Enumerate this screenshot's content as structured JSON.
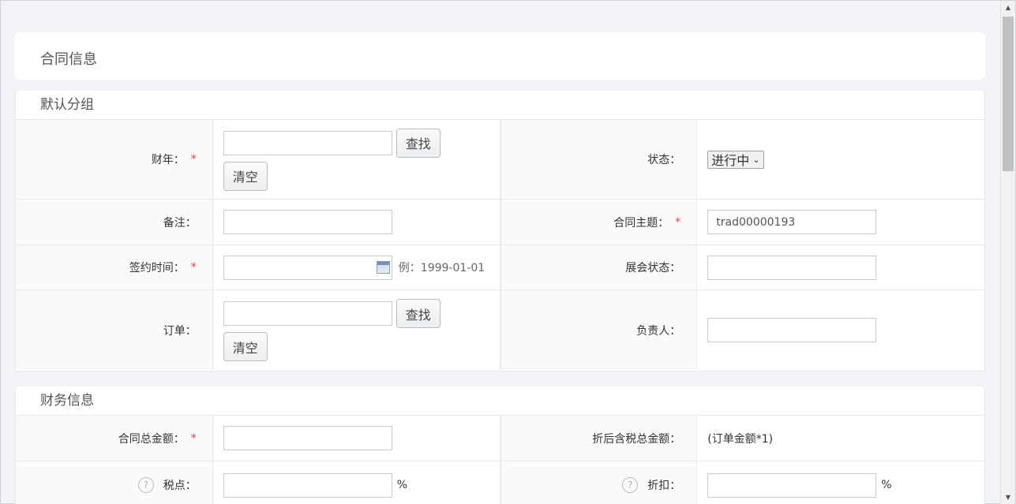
{
  "header": {
    "title": "合同信息"
  },
  "default_group": {
    "title": "默认分组",
    "fiscal_year": {
      "label": "财年：",
      "required": "*",
      "value": "",
      "find_label": "查找",
      "clear_label": "清空"
    },
    "status": {
      "label": "状态：",
      "selected": "进行中"
    },
    "remark": {
      "label": "备注：",
      "value": ""
    },
    "contract_subject": {
      "label": "合同主题：",
      "required": "*",
      "value": "trad00000193"
    },
    "sign_time": {
      "label": "签约时间：",
      "required": "*",
      "value": "",
      "example": "例：1999-01-01"
    },
    "exhibition_status": {
      "label": "展会状态：",
      "value": ""
    },
    "order": {
      "label": "订单：",
      "value": "",
      "find_label": "查找",
      "clear_label": "清空"
    },
    "owner": {
      "label": "负责人：",
      "value": ""
    }
  },
  "finance": {
    "title": "财务信息",
    "total_amount": {
      "label": "合同总金额：",
      "required": "*",
      "value": ""
    },
    "discounted_total": {
      "label": "折后含税总金额：",
      "value": "(订单金额*1)"
    },
    "tax_rate": {
      "label": "税点：",
      "value": "",
      "unit": "%",
      "help_icon": "?"
    },
    "discount": {
      "label": "折扣：",
      "value": "",
      "unit": "%",
      "help_icon": "?"
    }
  }
}
